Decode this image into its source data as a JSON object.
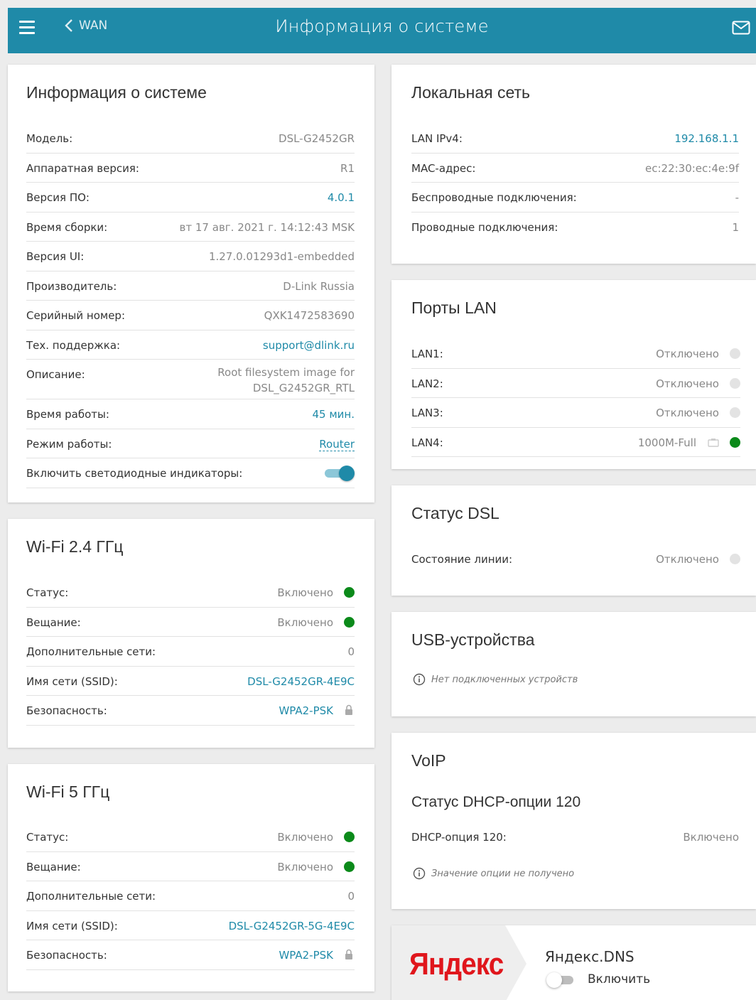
{
  "header": {
    "back_label": "WAN",
    "title": "Информация о системе"
  },
  "system": {
    "title": "Информация о системе",
    "rows": [
      {
        "label": "Модель:",
        "value": "DSL-G2452GR"
      },
      {
        "label": "Аппаратная версия:",
        "value": "R1"
      },
      {
        "label": "Версия ПО:",
        "value": "4.0.1"
      },
      {
        "label": "Время сборки:",
        "value": "вт 17 авг. 2021 г. 14:12:43 MSK"
      },
      {
        "label": "Версия UI:",
        "value": "1.27.0.01293d1-embedded"
      },
      {
        "label": "Производитель:",
        "value": "D-Link Russia"
      },
      {
        "label": "Серийный номер:",
        "value": "QXK1472583690"
      },
      {
        "label": "Тех. поддержка:",
        "value": "support@dlink.ru"
      },
      {
        "label": "Описание:",
        "value_line1": "Root filesystem image for",
        "value_line2": "DSL_G2452GR_RTL"
      },
      {
        "label": "Время работы:",
        "value": "45 мин."
      },
      {
        "label": "Режим работы:",
        "value": "Router"
      },
      {
        "label": "Включить светодиодные индикаторы:"
      }
    ]
  },
  "wifi24": {
    "title": "Wi-Fi 2.4 ГГц",
    "rows": [
      {
        "label": "Статус:",
        "value": "Включено"
      },
      {
        "label": "Вещание:",
        "value": "Включено"
      },
      {
        "label": "Дополнительные сети:",
        "value": "0"
      },
      {
        "label": "Имя сети (SSID):",
        "value": "DSL-G2452GR-4E9C"
      },
      {
        "label": "Безопасность:",
        "value": "WPA2-PSK"
      }
    ]
  },
  "wifi5": {
    "title": "Wi-Fi 5 ГГц",
    "rows": [
      {
        "label": "Статус:",
        "value": "Включено"
      },
      {
        "label": "Вещание:",
        "value": "Включено"
      },
      {
        "label": "Дополнительные сети:",
        "value": "0"
      },
      {
        "label": "Имя сети (SSID):",
        "value": "DSL-G2452GR-5G-4E9C"
      },
      {
        "label": "Безопасность:",
        "value": "WPA2-PSK"
      }
    ]
  },
  "lan": {
    "title": "Локальная сеть",
    "rows": [
      {
        "label": "LAN IPv4:",
        "value": "192.168.1.1"
      },
      {
        "label": "MAC-адрес:",
        "value": "ec:22:30:ec:4e:9f"
      },
      {
        "label": "Беспроводные подключения:",
        "value": "-"
      },
      {
        "label": "Проводные подключения:",
        "value": "1"
      }
    ]
  },
  "ports": {
    "title": "Порты LAN",
    "rows": [
      {
        "label": "LAN1:",
        "value": "Отключено"
      },
      {
        "label": "LAN2:",
        "value": "Отключено"
      },
      {
        "label": "LAN3:",
        "value": "Отключено"
      },
      {
        "label": "LAN4:",
        "value": "1000M-Full"
      }
    ]
  },
  "dsl": {
    "title": "Статус DSL",
    "rows": [
      {
        "label": "Состояние линии:",
        "value": "Отключено"
      }
    ]
  },
  "usb": {
    "title": "USB-устройства",
    "note": "Нет подключенных устройств"
  },
  "voip": {
    "title": "VoIP",
    "subtitle": "Статус DHCP-опции 120",
    "rows": [
      {
        "label": "DHCP-опция 120:",
        "value": "Включено"
      }
    ],
    "note": "Значение опции не получено"
  },
  "yandex": {
    "logo": "Яндекс",
    "title": "Яндекс.DNS",
    "toggle_label": "Включить"
  },
  "colors": {
    "accent": "#1f8aa8",
    "status_on": "#0b8a1a",
    "status_off": "#e3e3e3",
    "yandex_red": "#e0161c"
  },
  "toggles": {
    "leds": true,
    "yandex_dns": false
  }
}
